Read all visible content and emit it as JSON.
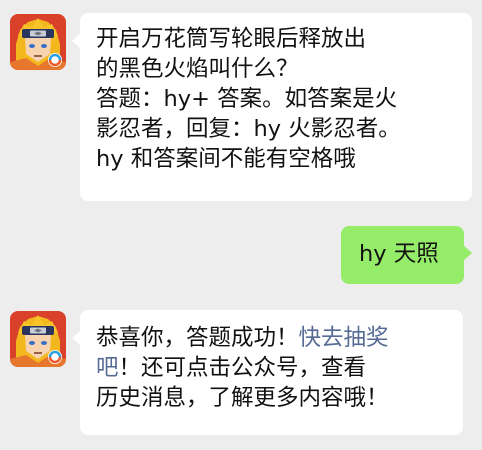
{
  "chat": {
    "colors": {
      "background": "#ededed",
      "incoming_bubble": "#ffffff",
      "outgoing_bubble": "#95ec69",
      "link": "#576b95"
    },
    "messages": [
      {
        "sender": "official-account",
        "lines": [
          "开启万花筒写轮眼后释放出",
          "的黑色火焰叫什么？",
          "答题：hy+ 答案。如答案是火",
          "影忍者，回复：hy 火影忍者。",
          "hy 和答案间不能有空格哦"
        ]
      },
      {
        "sender": "me",
        "text": "hy 天照"
      },
      {
        "sender": "official-account",
        "line1_text": "恭喜你，答题成功！",
        "line1_link": "快去抽奖",
        "line2_link": "吧",
        "line2_text": "！还可点击公众号，查看",
        "line3_text": "历史消息，了解更多内容哦！"
      }
    ]
  }
}
